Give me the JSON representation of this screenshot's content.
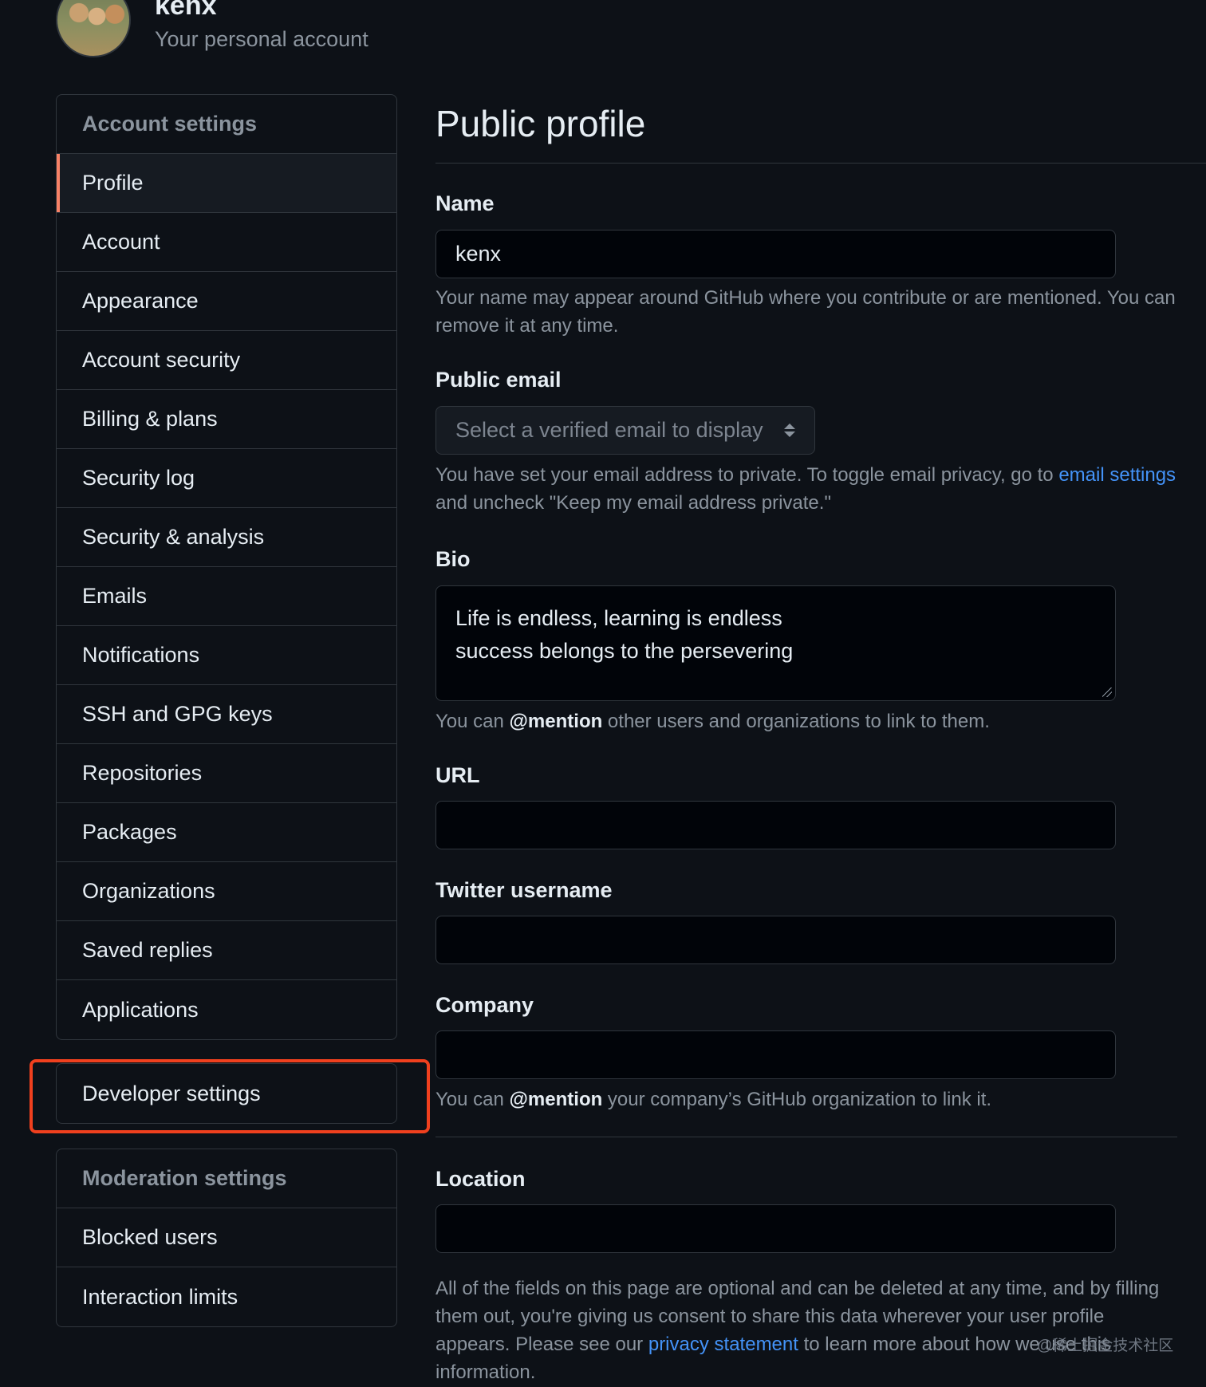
{
  "header": {
    "username": "kenx",
    "subtitle": "Your personal account"
  },
  "sidebar": {
    "account_settings_heading": "Account settings",
    "items": [
      {
        "label": "Profile"
      },
      {
        "label": "Account"
      },
      {
        "label": "Appearance"
      },
      {
        "label": "Account security"
      },
      {
        "label": "Billing & plans"
      },
      {
        "label": "Security log"
      },
      {
        "label": "Security & analysis"
      },
      {
        "label": "Emails"
      },
      {
        "label": "Notifications"
      },
      {
        "label": "SSH and GPG keys"
      },
      {
        "label": "Repositories"
      },
      {
        "label": "Packages"
      },
      {
        "label": "Organizations"
      },
      {
        "label": "Saved replies"
      },
      {
        "label": "Applications"
      }
    ],
    "selected_item": "Profile",
    "developer_settings": "Developer settings",
    "moderation_heading": "Moderation settings",
    "moderation_items": [
      {
        "label": "Blocked users"
      },
      {
        "label": "Interaction limits"
      }
    ]
  },
  "main": {
    "title": "Public profile",
    "name": {
      "label": "Name",
      "value": "kenx",
      "note": "Your name may appear around GitHub where you contribute or are mentioned. You can remove it at any time."
    },
    "public_email": {
      "label": "Public email",
      "select_value": "Select a verified email to display",
      "note_before": "You have set your email address to private. To toggle email privacy, go to ",
      "note_link": "email settings",
      "note_after": " and uncheck \"Keep my email address private.\""
    },
    "bio": {
      "label": "Bio",
      "line1": "Life is endless, learning is endless",
      "line2": "success belongs to the persevering",
      "note_before": "You can ",
      "note_mention": "@mention",
      "note_after": " other users and organizations to link to them."
    },
    "url": {
      "label": "URL",
      "value": ""
    },
    "twitter": {
      "label": "Twitter username",
      "value": ""
    },
    "company": {
      "label": "Company",
      "value": "",
      "note_before": "You can ",
      "note_mention": "@mention",
      "note_after": " your company’s GitHub organization to link it."
    },
    "location": {
      "label": "Location",
      "value": ""
    },
    "footer": {
      "text_before": "All of the fields on this page are optional and can be deleted at any time, and by filling them out, you're giving us consent to share this data wherever your user profile appears. Please see our ",
      "link": "privacy statement",
      "text_after": " to learn more about how we use this information."
    }
  },
  "watermark": "@稀土掘金技术社区",
  "colors": {
    "background": "#0d1117",
    "accent_selected": "#f78166",
    "link": "#4493f8",
    "highlight_box": "#f0401e"
  }
}
